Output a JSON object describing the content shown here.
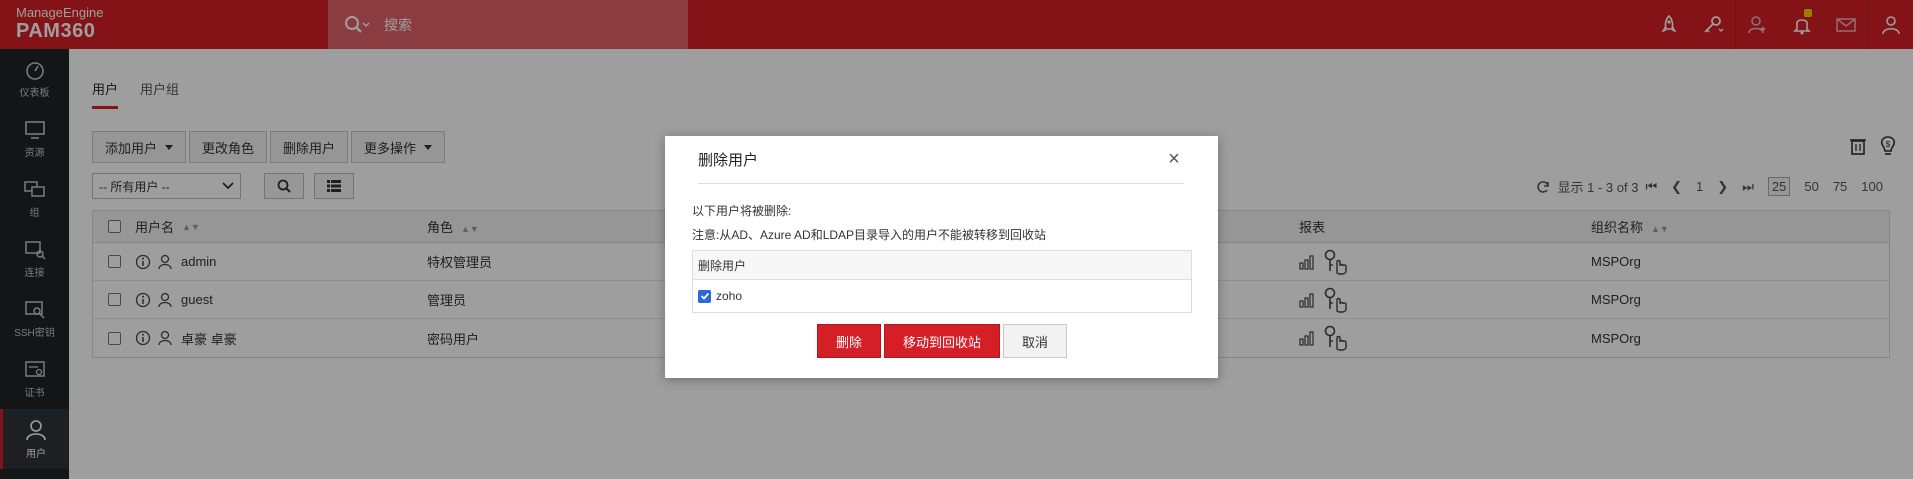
{
  "brand": {
    "maker": "ManageEngine",
    "product": "PAM360"
  },
  "search": {
    "placeholder": "搜索"
  },
  "sidebar": {
    "items": [
      {
        "label": "仪表板",
        "icon": "dashboard-icon"
      },
      {
        "label": "资源",
        "icon": "monitor-icon"
      },
      {
        "label": "组",
        "icon": "group-monitors-icon"
      },
      {
        "label": "连接",
        "icon": "connection-icon"
      },
      {
        "label": "SSH密钥",
        "icon": "ssh-key-icon"
      },
      {
        "label": "证书",
        "icon": "certificate-icon"
      },
      {
        "label": "用户",
        "icon": "user-icon",
        "active": true
      }
    ]
  },
  "tabs": [
    {
      "label": "用户",
      "active": true
    },
    {
      "label": "用户组"
    }
  ],
  "toolbar": {
    "add_user": "添加用户",
    "change_role": "更改角色",
    "delete_user": "删除用户",
    "more_actions": "更多操作"
  },
  "filter": {
    "selected": "-- 所有用户 --"
  },
  "pager": {
    "display_text": "显示 1 - 3 of 3",
    "current_page": "1",
    "sizes": [
      "25",
      "50",
      "75",
      "100"
    ],
    "selected_size": "25"
  },
  "table": {
    "headers": {
      "username": "用户名",
      "role": "角色",
      "reports": "报表",
      "org": "组织名称"
    },
    "rows": [
      {
        "username": "admin",
        "role": "特权管理员",
        "org": "MSPOrg"
      },
      {
        "username": "guest",
        "role": "管理员",
        "org": "MSPOrg"
      },
      {
        "username": "卓豪 卓豪",
        "role": "密码用户",
        "org": "MSPOrg"
      }
    ]
  },
  "dialog": {
    "title": "删除用户",
    "close": "×",
    "line1": "以下用户将被删除:",
    "line2": "注意:从AD、Azure AD和LDAP目录导入的用户不能被转移到回收站",
    "table_header": "删除用户",
    "users": [
      {
        "name": "zoho",
        "checked": true
      }
    ],
    "buttons": {
      "delete": "删除",
      "move_to_bin": "移动到回收站",
      "cancel": "取消"
    }
  },
  "colors": {
    "brand_red": "#d41f26",
    "sidebar": "#1f2326",
    "checkbox_blue": "#2a6ad8"
  }
}
